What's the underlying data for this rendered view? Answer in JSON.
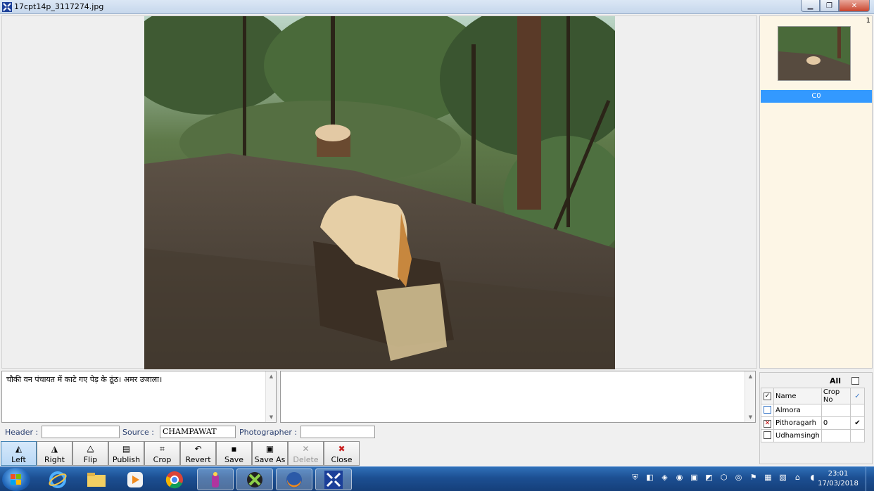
{
  "window": {
    "title": "17cpt14p_3117274.jpg",
    "minimize_icon": "minimize-icon",
    "maximize_icon": "maximize-icon",
    "close_icon": "close-icon"
  },
  "thumbnails": {
    "index": "1",
    "items": [
      {
        "label": "C0"
      }
    ]
  },
  "caption": {
    "text": "चौकी वन पंचायत में काटे गए पेड़ के ठूंठ। अमर उजाला।"
  },
  "notes": {
    "text": ""
  },
  "fields": {
    "header_label": "Header :",
    "header_value": "",
    "source_label": "Source :",
    "source_value": "CHAMPAWAT",
    "photographer_label": "Photographer :",
    "photographer_value": ""
  },
  "toolbar": {
    "left": "Left",
    "right": "Right",
    "flip": "Flip",
    "publish": "Publish",
    "crop": "Crop",
    "revert": "Revert",
    "save": "Save",
    "save_as": "Save As",
    "delete": "Delete",
    "close": "Close"
  },
  "districts": {
    "all_label": "All",
    "columns": [
      "Name",
      "Crop No",
      "✓"
    ],
    "rows": [
      {
        "name": "Almora",
        "crop_no": "",
        "checked": ""
      },
      {
        "name": "Pithoragarh",
        "crop_no": "0",
        "checked": "✔"
      },
      {
        "name": "Udhamsingh",
        "crop_no": "",
        "checked": ""
      }
    ]
  },
  "taskbar": {
    "time": "23:01",
    "date": "17/03/2018",
    "apps": [
      "internet-explorer-icon",
      "file-explorer-icon",
      "media-player-icon",
      "chrome-icon",
      "app-icon",
      "app-icon",
      "firefox-icon",
      "image-viewer-icon"
    ]
  },
  "colors": {
    "selection": "#3399ff",
    "taskbar": "#1c4f92",
    "thumb_panel": "#fdf6e6"
  }
}
